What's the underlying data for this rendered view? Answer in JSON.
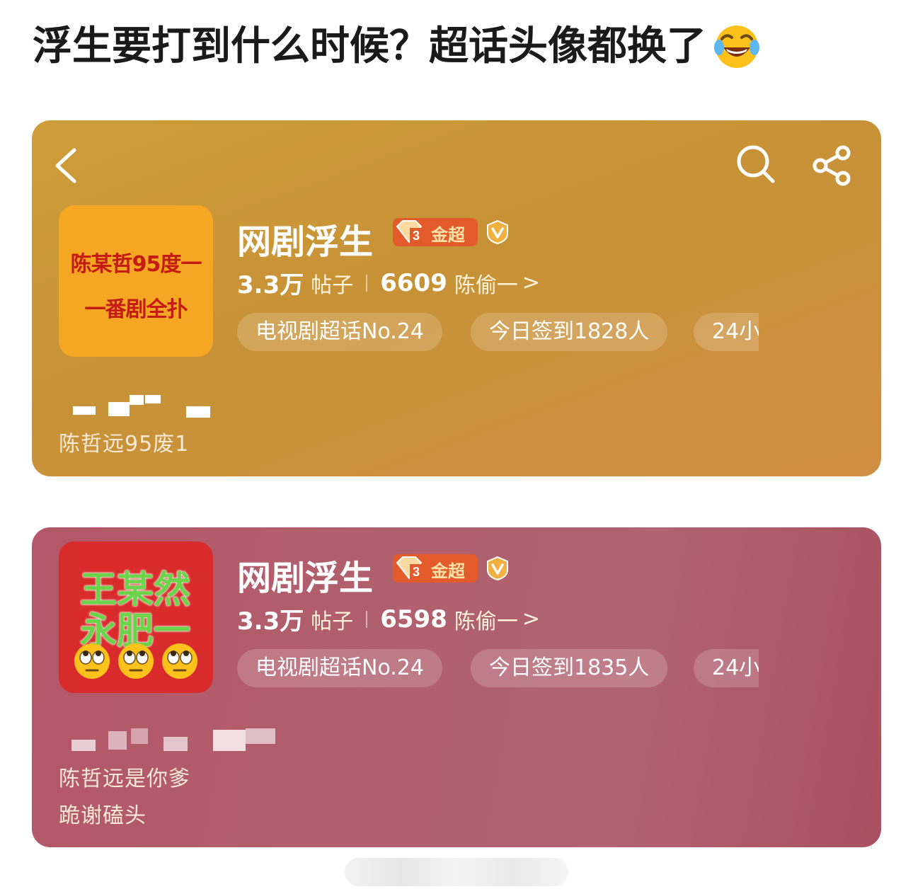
{
  "post": {
    "title": "浮生要打到什么时候？超话头像都换了",
    "title_emoji": "face-with-tears-of-joy-icon"
  },
  "cards": [
    {
      "theme_color": "#c8953a",
      "avatar_text_line1": "陈某哲95度一",
      "avatar_text_line2": "一番剧全扑",
      "name": "网剧浮生",
      "badge_label": "金超",
      "posts_count": "3.3万",
      "posts_label": "帖子",
      "fans_count": "6609",
      "fans_label": "陈偷一",
      "fans_arrow": ">",
      "chips": [
        "电视剧超话No.24",
        "今日签到1828人",
        "24小"
      ],
      "description_lines": [
        "陈哲远95废1"
      ]
    },
    {
      "theme_color": "#b05b6a",
      "avatar_text_line1": "王某然",
      "avatar_text_line2": "永肥一",
      "avatar_emojis": [
        "face-with-rolling-eyes-icon",
        "face-with-rolling-eyes-icon",
        "face-with-rolling-eyes-icon"
      ],
      "name": "网剧浮生",
      "badge_label": "金超",
      "posts_count": "3.3万",
      "posts_label": "帖子",
      "fans_count": "6598",
      "fans_label": "陈偷一",
      "fans_arrow": ">",
      "chips": [
        "电视剧超话No.24",
        "今日签到1835人",
        "24小"
      ],
      "description_lines": [
        "陈哲远是你爹",
        "跪谢磕头"
      ]
    }
  ],
  "icons": {
    "back": "chevron-left-icon",
    "search": "search-icon",
    "share": "share-icon",
    "gold_gem": "diamond-gem-icon",
    "verified": "verified-v-icon"
  }
}
